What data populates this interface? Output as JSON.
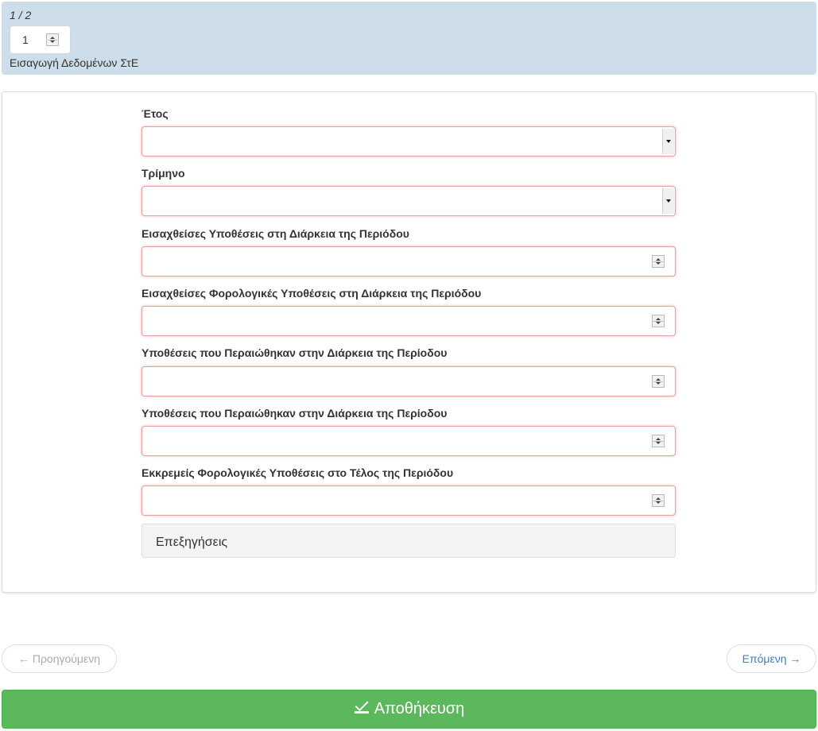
{
  "header": {
    "page_counter": "1 / 2",
    "page_input_value": "1",
    "form_title": "Εισαγωγή Δεδομένων ΣτΕ"
  },
  "fields": [
    {
      "label": "Έτος",
      "type": "select",
      "value": ""
    },
    {
      "label": "Τρίμηνο",
      "type": "select",
      "value": ""
    },
    {
      "label": "Εισαχθείσες Υποθέσεις στη Διάρκεια της Περιόδου",
      "type": "number",
      "value": ""
    },
    {
      "label": "Εισαχθείσες Φορολογικές Υποθέσεις στη Διάρκεια της Περιόδου",
      "type": "number",
      "value": ""
    },
    {
      "label": "Υποθέσεις που Περαιώθηκαν στην Διάρκεια της Περίοδου",
      "type": "number",
      "value": ""
    },
    {
      "label": "Υποθέσεις που Περαιώθηκαν στην Διάρκεια της Περίοδου",
      "type": "number",
      "value": ""
    },
    {
      "label": "Εκκρεμείς Φορολογικές Υποθέσεις στο Τέλος της Περιόδου",
      "type": "number",
      "value": ""
    }
  ],
  "explanations_label": "Επεξηγήσεις",
  "navigation": {
    "prev_label": "← Προηγούμενη",
    "next_label": "Επόμενη →"
  },
  "save": {
    "label": "Αποθήκευση",
    "icon": "check-square-icon"
  },
  "colors": {
    "header_bg": "#cddde9",
    "invalid_border": "#e8a0a0",
    "save_green": "#5cb85c",
    "next_link": "#3a7fc0"
  }
}
